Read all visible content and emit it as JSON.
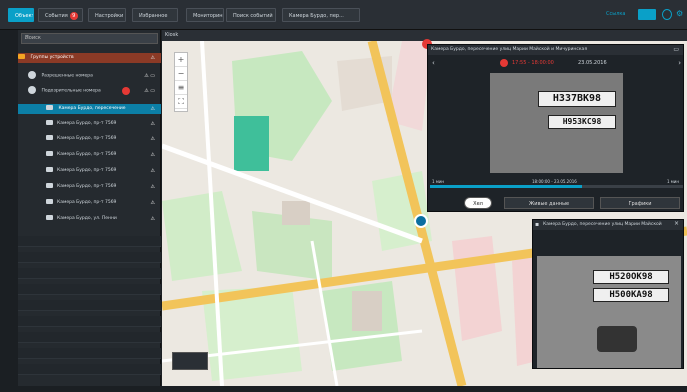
{
  "topbar": {
    "tabs": [
      "Объекты",
      "События",
      "Настройки",
      "Избранное",
      "Мониторинг",
      "Поиск событий",
      "Камера Бурдо, пер..."
    ],
    "events_badge": "9",
    "right_label": "Ссылка"
  },
  "sidebar": {
    "search_placeholder": "Поиск",
    "group_header": "Группы устройств",
    "items": [
      "Разрешенные номера",
      "Подозрительные номера",
      "Камера Бурдо, пересечение",
      "Камера Бурдо, пр-т 7569",
      "Камера Бурдо, пр-т 7569",
      "Камера Бурдо, пр-т 7569",
      "Камера Бурдо, пр-т 7569",
      "Камера Бурдо, пр-т 7569",
      "Камера Бурдо, пр-т 7569",
      "Камера Бурдо, ул. Пенни"
    ]
  },
  "map": {
    "title": "Kiosk"
  },
  "panel1": {
    "title": "Камера Бурдо, пересечение улиц Марии Майской и Мичуринская",
    "time": "17:55 - 18:00:00",
    "date": "23.05.2016",
    "plates": [
      "Н337ВК98",
      "Н953КС98"
    ],
    "time_left": "1 мин",
    "time_center": "18:00:00 - 23.05.2016",
    "time_right": "1 мин",
    "buttons": [
      "Хел",
      "Живые данные",
      "Графики"
    ]
  },
  "panel2": {
    "title": "Камера Бурдо, пересечение улиц Марии Майской",
    "plates": [
      "Н520ОК98",
      "Н500КА98"
    ]
  }
}
